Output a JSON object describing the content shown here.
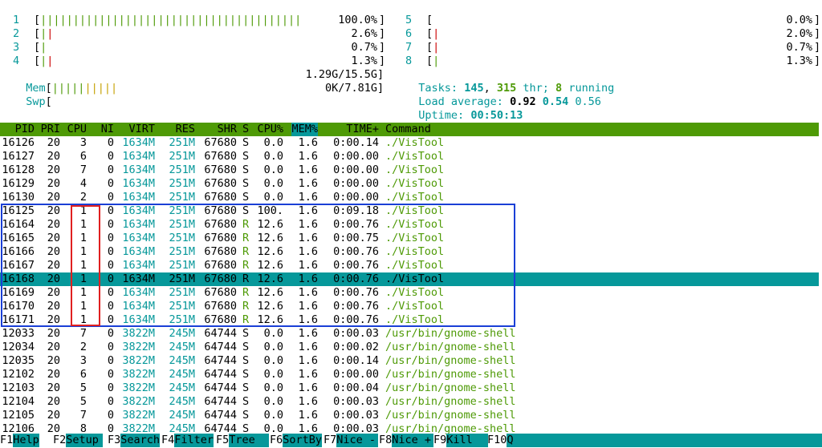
{
  "meters": {
    "cpus": [
      {
        "num": "1",
        "bars": [
          [
            "g",
            "||||||||||||||||||||||||||||||||||||||||"
          ]
        ],
        "value": "100.0%"
      },
      {
        "num": "2",
        "bars": [
          [
            "g",
            "|"
          ],
          [
            "r",
            "|"
          ]
        ],
        "value": "2.6%"
      },
      {
        "num": "3",
        "bars": [
          [
            "g",
            "|"
          ]
        ],
        "value": "0.7%"
      },
      {
        "num": "4",
        "bars": [
          [
            "g",
            "|"
          ],
          [
            "r",
            "|"
          ]
        ],
        "value": "1.3%"
      },
      {
        "num": "5",
        "bars": [],
        "value": "0.0%"
      },
      {
        "num": "6",
        "bars": [
          [
            "r",
            "|"
          ]
        ],
        "value": "2.0%"
      },
      {
        "num": "7",
        "bars": [
          [
            "r",
            "|"
          ]
        ],
        "value": "0.7%"
      },
      {
        "num": "8",
        "bars": [
          [
            "g",
            "|"
          ]
        ],
        "value": "1.3%"
      }
    ],
    "mem": {
      "label": "Mem",
      "bars": [
        [
          "g",
          "|||||"
        ],
        [
          "y",
          "|||||"
        ]
      ],
      "value": "1.29G/15.5G"
    },
    "swp": {
      "label": "Swp",
      "value": "0K/7.81G"
    }
  },
  "summary": {
    "tasks_label": "Tasks:",
    "tasks": "145",
    "thr": "315",
    "thr_label": "thr;",
    "running": "8",
    "running_label": "running",
    "load_label": "Load average:",
    "load1": "0.92",
    "load5": "0.54",
    "load15": "0.56",
    "uptime_label": "Uptime:",
    "uptime": "00:50:13"
  },
  "columns": [
    "PID",
    "PRI",
    "CPU",
    "NI",
    "VIRT",
    "RES",
    "SHR",
    "S",
    "CPU%",
    "MEM%",
    "TIME+",
    "Command"
  ],
  "sorted_column": "MEM%",
  "processes": [
    [
      "16126",
      "20",
      "3",
      "0",
      "1634M",
      "251M",
      "67680",
      "S",
      "0.0",
      "1.6",
      "0:00.14",
      "./VisTool"
    ],
    [
      "16127",
      "20",
      "6",
      "0",
      "1634M",
      "251M",
      "67680",
      "S",
      "0.0",
      "1.6",
      "0:00.00",
      "./VisTool"
    ],
    [
      "16128",
      "20",
      "7",
      "0",
      "1634M",
      "251M",
      "67680",
      "S",
      "0.0",
      "1.6",
      "0:00.00",
      "./VisTool"
    ],
    [
      "16129",
      "20",
      "4",
      "0",
      "1634M",
      "251M",
      "67680",
      "S",
      "0.0",
      "1.6",
      "0:00.00",
      "./VisTool"
    ],
    [
      "16130",
      "20",
      "2",
      "0",
      "1634M",
      "251M",
      "67680",
      "S",
      "0.0",
      "1.6",
      "0:00.00",
      "./VisTool"
    ],
    [
      "16125",
      "20",
      "1",
      "0",
      "1634M",
      "251M",
      "67680",
      "S",
      "100.",
      "1.6",
      "0:09.18",
      "./VisTool"
    ],
    [
      "16164",
      "20",
      "1",
      "0",
      "1634M",
      "251M",
      "67680",
      "R",
      "12.6",
      "1.6",
      "0:00.76",
      "./VisTool"
    ],
    [
      "16165",
      "20",
      "1",
      "0",
      "1634M",
      "251M",
      "67680",
      "R",
      "12.6",
      "1.6",
      "0:00.75",
      "./VisTool"
    ],
    [
      "16166",
      "20",
      "1",
      "0",
      "1634M",
      "251M",
      "67680",
      "R",
      "12.6",
      "1.6",
      "0:00.76",
      "./VisTool"
    ],
    [
      "16167",
      "20",
      "1",
      "0",
      "1634M",
      "251M",
      "67680",
      "R",
      "12.6",
      "1.6",
      "0:00.76",
      "./VisTool"
    ],
    [
      "16168",
      "20",
      "1",
      "0",
      "1634M",
      "251M",
      "67680",
      "R",
      "12.6",
      "1.6",
      "0:00.76",
      "./VisTool"
    ],
    [
      "16169",
      "20",
      "1",
      "0",
      "1634M",
      "251M",
      "67680",
      "R",
      "12.6",
      "1.6",
      "0:00.76",
      "./VisTool"
    ],
    [
      "16170",
      "20",
      "1",
      "0",
      "1634M",
      "251M",
      "67680",
      "R",
      "12.6",
      "1.6",
      "0:00.76",
      "./VisTool"
    ],
    [
      "16171",
      "20",
      "1",
      "0",
      "1634M",
      "251M",
      "67680",
      "R",
      "12.6",
      "1.6",
      "0:00.76",
      "./VisTool"
    ],
    [
      "12033",
      "20",
      "7",
      "0",
      "3822M",
      "245M",
      "64744",
      "S",
      "0.0",
      "1.6",
      "0:00.03",
      "/usr/bin/gnome-shell"
    ],
    [
      "12034",
      "20",
      "2",
      "0",
      "3822M",
      "245M",
      "64744",
      "S",
      "0.0",
      "1.6",
      "0:00.02",
      "/usr/bin/gnome-shell"
    ],
    [
      "12035",
      "20",
      "3",
      "0",
      "3822M",
      "245M",
      "64744",
      "S",
      "0.0",
      "1.6",
      "0:00.14",
      "/usr/bin/gnome-shell"
    ],
    [
      "12102",
      "20",
      "6",
      "0",
      "3822M",
      "245M",
      "64744",
      "S",
      "0.0",
      "1.6",
      "0:00.00",
      "/usr/bin/gnome-shell"
    ],
    [
      "12103",
      "20",
      "5",
      "0",
      "3822M",
      "245M",
      "64744",
      "S",
      "0.0",
      "1.6",
      "0:00.04",
      "/usr/bin/gnome-shell"
    ],
    [
      "12104",
      "20",
      "5",
      "0",
      "3822M",
      "245M",
      "64744",
      "S",
      "0.0",
      "1.6",
      "0:00.03",
      "/usr/bin/gnome-shell"
    ],
    [
      "12105",
      "20",
      "7",
      "0",
      "3822M",
      "245M",
      "64744",
      "S",
      "0.0",
      "1.6",
      "0:00.03",
      "/usr/bin/gnome-shell"
    ],
    [
      "12106",
      "20",
      "8",
      "0",
      "3822M",
      "245M",
      "64744",
      "S",
      "0.0",
      "1.6",
      "0:00.03",
      "/usr/bin/gnome-shell"
    ]
  ],
  "selected_row": 10,
  "footer": [
    {
      "key": "F1",
      "label": "Help"
    },
    {
      "key": "F2",
      "label": "Setup"
    },
    {
      "key": "F3",
      "label": "Search"
    },
    {
      "key": "F4",
      "label": "Filter"
    },
    {
      "key": "F5",
      "label": "Tree"
    },
    {
      "key": "F6",
      "label": "SortBy"
    },
    {
      "key": "F7",
      "label": "Nice -"
    },
    {
      "key": "F8",
      "label": "Nice +"
    },
    {
      "key": "F9",
      "label": "Kill"
    },
    {
      "key": "F10",
      "label": "Quit"
    }
  ],
  "colors": {
    "header_bg": "#4e9a06",
    "highlight": "#06989a",
    "annotation_blue": "#1a3fd6",
    "annotation_red": "#e02020"
  }
}
